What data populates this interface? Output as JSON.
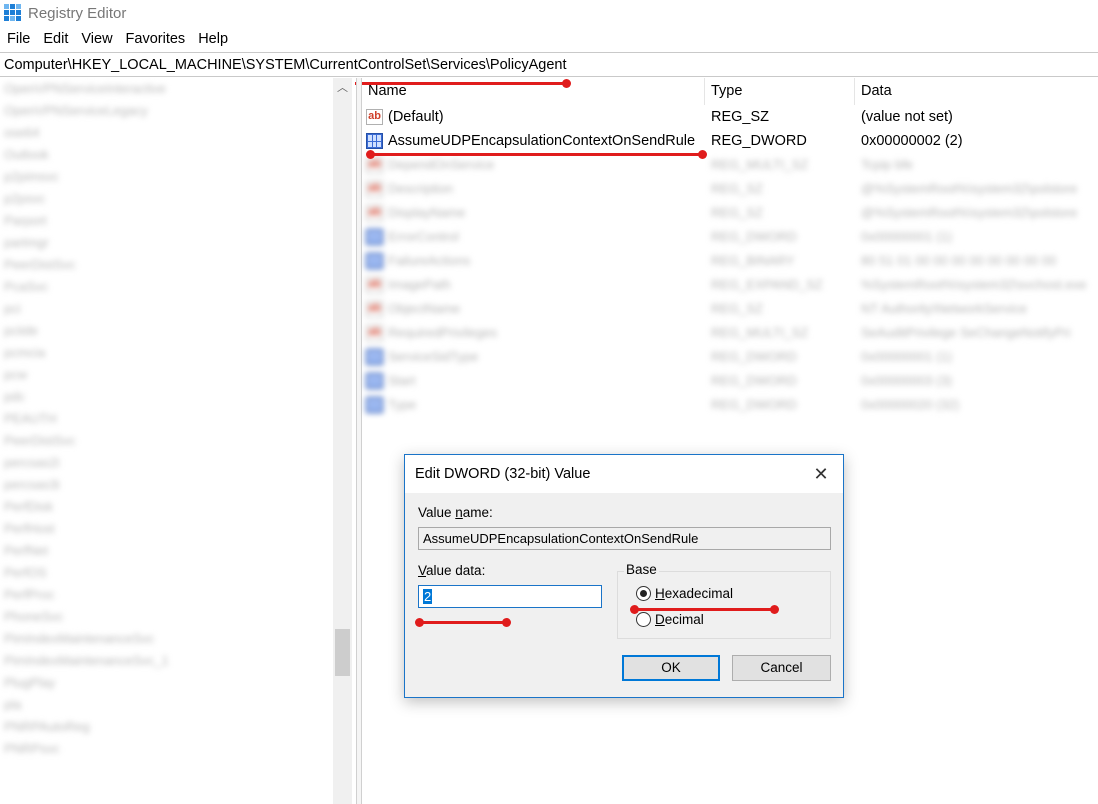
{
  "window": {
    "title": "Registry Editor",
    "icon": "registry-editor-icon"
  },
  "menu": [
    {
      "label": "File"
    },
    {
      "label": "Edit"
    },
    {
      "label": "View"
    },
    {
      "label": "Favorites"
    },
    {
      "label": "Help"
    }
  ],
  "address": {
    "path": "Computer\\HKEY_LOCAL_MACHINE\\SYSTEM\\CurrentControlSet\\Services\\PolicyAgent"
  },
  "tree": {
    "items": [
      "OpenVPNServiceInteractive",
      "OpenVPNServiceLegacy",
      "ose64",
      "Outlook",
      "p2pimsvc",
      "p2psvc",
      "Parport",
      "partmgr",
      "PeerDistSvc",
      "PcaSvc",
      "pci",
      "pciide",
      "pcmcia",
      "pcw",
      "pdc",
      "PEAUTH",
      "PeerDistSvc",
      "percsas2i",
      "percsas3i",
      "PerfDisk",
      "PerfHost",
      "PerfNet",
      "PerfOS",
      "PerfProc",
      "PhoneSvc",
      "PimIndexMaintenanceSvc",
      "PimIndexMaintenanceSvc_1",
      "PlugPlay",
      "pla",
      "PNRPAutoReg",
      "PNRPsvc"
    ]
  },
  "list": {
    "columns": {
      "name": "Name",
      "type": "Type",
      "data": "Data"
    },
    "rows": [
      {
        "icon": "string-value-icon",
        "name": "(Default)",
        "type": "REG_SZ",
        "data": "(value not set)"
      },
      {
        "icon": "dword-value-icon",
        "name": "AssumeUDPEncapsulationContextOnSendRule",
        "type": "REG_DWORD",
        "data": "0x00000002 (2)"
      },
      {
        "icon": "string-value-icon",
        "name": "DependOnService",
        "type": "REG_MULTI_SZ",
        "data": "Tcpip bfe"
      },
      {
        "icon": "string-value-icon",
        "name": "Description",
        "type": "REG_SZ",
        "data": "@%SystemRoot%\\system32\\polstore"
      },
      {
        "icon": "string-value-icon",
        "name": "DisplayName",
        "type": "REG_SZ",
        "data": "@%SystemRoot%\\system32\\polstore"
      },
      {
        "icon": "dword-value-icon",
        "name": "ErrorControl",
        "type": "REG_DWORD",
        "data": "0x00000001 (1)"
      },
      {
        "icon": "dword-value-icon",
        "name": "FailureActions",
        "type": "REG_BINARY",
        "data": "80 51 01 00 00 00 00 00 00 00 00"
      },
      {
        "icon": "string-value-icon",
        "name": "ImagePath",
        "type": "REG_EXPAND_SZ",
        "data": "%SystemRoot%\\system32\\svchost.exe"
      },
      {
        "icon": "string-value-icon",
        "name": "ObjectName",
        "type": "REG_SZ",
        "data": "NT Authority\\NetworkService"
      },
      {
        "icon": "string-value-icon",
        "name": "RequiredPrivileges",
        "type": "REG_MULTI_SZ",
        "data": "SeAuditPrivilege SeChangeNotifyPri"
      },
      {
        "icon": "dword-value-icon",
        "name": "ServiceSidType",
        "type": "REG_DWORD",
        "data": "0x00000001 (1)"
      },
      {
        "icon": "dword-value-icon",
        "name": "Start",
        "type": "REG_DWORD",
        "data": "0x00000003 (3)"
      },
      {
        "icon": "dword-value-icon",
        "name": "Type",
        "type": "REG_DWORD",
        "data": "0x00000020 (32)"
      }
    ]
  },
  "dialog": {
    "title": "Edit DWORD (32-bit) Value",
    "value_name_label": "Value name:",
    "value_name": "AssumeUDPEncapsulationContextOnSendRule",
    "value_data_label": "Value data:",
    "value_data": "2",
    "base_label": "Base",
    "base_options": [
      {
        "label": "Hexadecimal",
        "selected": true
      },
      {
        "label": "Decimal",
        "selected": false
      }
    ],
    "ok_label": "OK",
    "cancel_label": "Cancel"
  },
  "colors": {
    "accent": "#0078d7",
    "annotation": "#e01c1c",
    "dialog_border": "#1a74c8"
  }
}
